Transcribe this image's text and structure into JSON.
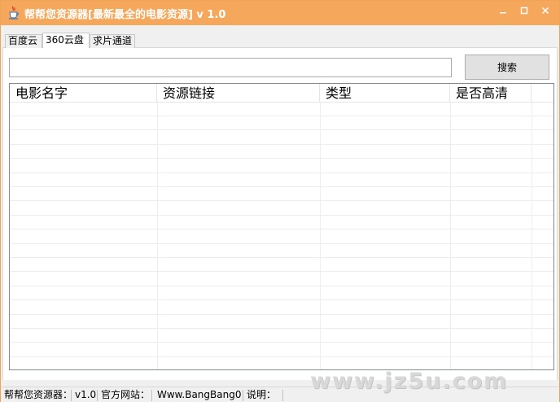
{
  "window": {
    "title": "帮帮您资源器[最新最全的电影资源] v 1.0",
    "accent_color": "#f5a85c",
    "icon": "java-cup-icon"
  },
  "window_controls": {
    "minimize_icon": "minimize-icon",
    "maximize_icon": "maximize-icon",
    "close_icon": "close-icon"
  },
  "tabs": [
    {
      "label": "百度云",
      "active": false
    },
    {
      "label": "360云盘",
      "active": true
    },
    {
      "label": "求片通道",
      "active": false
    }
  ],
  "search": {
    "value": "",
    "button_label": "搜索"
  },
  "table": {
    "columns": [
      "电影名字",
      "资源链接",
      "类型",
      "是否高清"
    ],
    "rows": []
  },
  "statusbar": {
    "app_name": "帮帮您资源器：",
    "version": "v1.0",
    "site_label": "官方网站：",
    "site_url": "Www.BangBang0.",
    "note_label": "说明："
  },
  "watermark": "www.jz5u.com"
}
